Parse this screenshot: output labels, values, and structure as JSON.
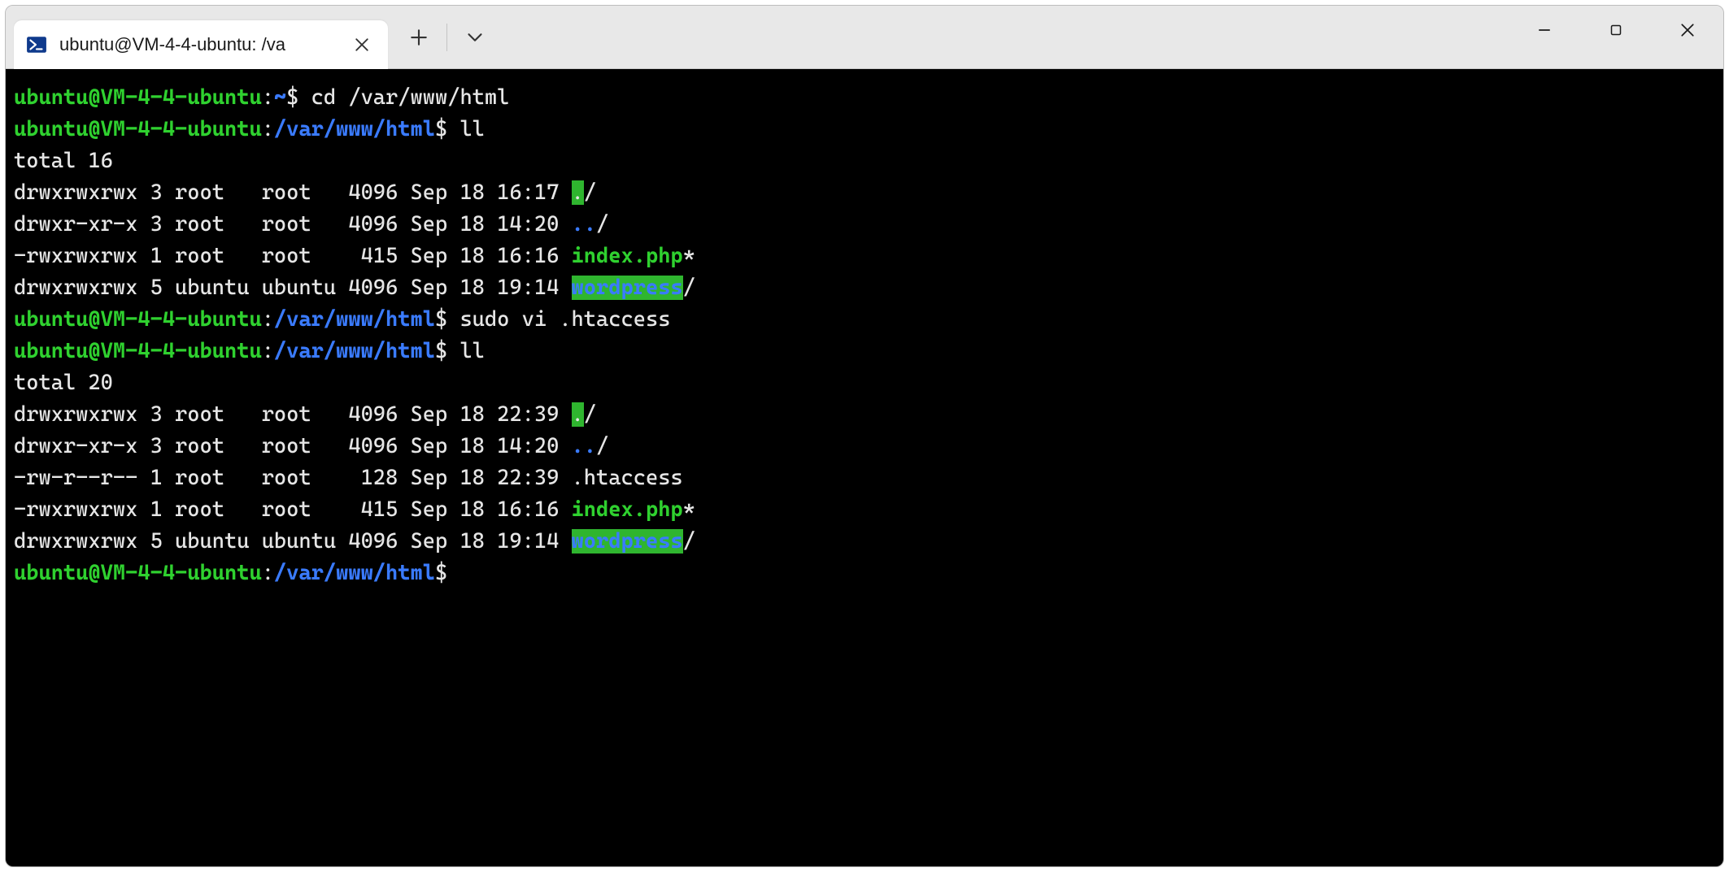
{
  "window": {
    "tab_title": "ubuntu@VM-4-4-ubuntu: /va",
    "tab_icon_alt": "powershell-icon"
  },
  "colors": {
    "user_green": "#2fd12f",
    "path_blue": "#3a7bff",
    "bg_black": "#000000",
    "hl_green": "#2fb52f"
  },
  "session": {
    "user_host": "ubuntu@VM-4-4-ubuntu",
    "home_path": "~",
    "cwd": "/var/www/html",
    "prompt_symbol": "$"
  },
  "lines": [
    {
      "type": "prompt",
      "path": "~",
      "cmd": "cd /var/www/html"
    },
    {
      "type": "prompt",
      "path": "/var/www/html",
      "cmd": "ll"
    },
    {
      "type": "plain",
      "text": "total 16"
    },
    {
      "type": "ls",
      "perm": "drwxrwxrwx",
      "links": "3",
      "owner": "root  ",
      "group": "root  ",
      "size": "4096",
      "date": "Sep 18 16:17",
      "name": ".",
      "style": "hldot",
      "suffix": "/"
    },
    {
      "type": "ls",
      "perm": "drwxr-xr-x",
      "links": "3",
      "owner": "root  ",
      "group": "root  ",
      "size": "4096",
      "date": "Sep 18 14:20",
      "name": "..",
      "style": "dir",
      "suffix": "/"
    },
    {
      "type": "ls",
      "perm": "-rwxrwxrwx",
      "links": "1",
      "owner": "root  ",
      "group": "root  ",
      "size": " 415",
      "date": "Sep 18 16:16",
      "name": "index.php",
      "style": "exe",
      "suffix": "*"
    },
    {
      "type": "ls",
      "perm": "drwxrwxrwx",
      "links": "5",
      "owner": "ubuntu",
      "group": "ubuntu",
      "size": "4096",
      "date": "Sep 18 19:14",
      "name": "wordpress",
      "style": "hl",
      "suffix": "/"
    },
    {
      "type": "prompt",
      "path": "/var/www/html",
      "cmd": "sudo vi .htaccess"
    },
    {
      "type": "prompt",
      "path": "/var/www/html",
      "cmd": "ll"
    },
    {
      "type": "plain",
      "text": "total 20"
    },
    {
      "type": "ls",
      "perm": "drwxrwxrwx",
      "links": "3",
      "owner": "root  ",
      "group": "root  ",
      "size": "4096",
      "date": "Sep 18 22:39",
      "name": ".",
      "style": "hldot",
      "suffix": "/"
    },
    {
      "type": "ls",
      "perm": "drwxr-xr-x",
      "links": "3",
      "owner": "root  ",
      "group": "root  ",
      "size": "4096",
      "date": "Sep 18 14:20",
      "name": "..",
      "style": "dir",
      "suffix": "/"
    },
    {
      "type": "ls",
      "perm": "-rw-r--r--",
      "links": "1",
      "owner": "root  ",
      "group": "root  ",
      "size": " 128",
      "date": "Sep 18 22:39",
      "name": ".htaccess",
      "style": "plain",
      "suffix": ""
    },
    {
      "type": "ls",
      "perm": "-rwxrwxrwx",
      "links": "1",
      "owner": "root  ",
      "group": "root  ",
      "size": " 415",
      "date": "Sep 18 16:16",
      "name": "index.php",
      "style": "exe",
      "suffix": "*"
    },
    {
      "type": "ls",
      "perm": "drwxrwxrwx",
      "links": "5",
      "owner": "ubuntu",
      "group": "ubuntu",
      "size": "4096",
      "date": "Sep 18 19:14",
      "name": "wordpress",
      "style": "hl",
      "suffix": "/"
    },
    {
      "type": "prompt",
      "path": "/var/www/html",
      "cmd": ""
    }
  ]
}
